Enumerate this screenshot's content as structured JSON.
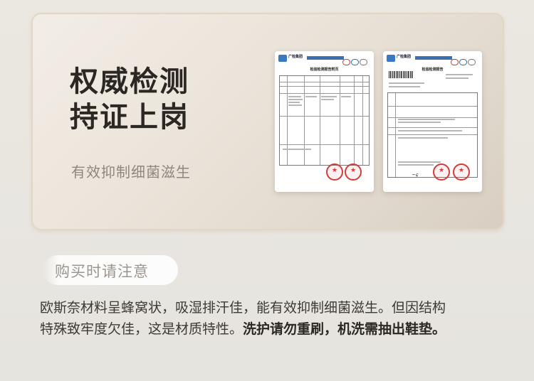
{
  "card": {
    "title_line1": "权威检测",
    "title_line2": "持证上岗",
    "subtitle": "有效抑制细菌滋生"
  },
  "reports": [
    {
      "header_org": "广检集团",
      "title": "检验检测报告附页",
      "icons": [
        "logo-icon",
        "cma-badge-icon",
        "cnas-badge-icon",
        "cert-badge-icon",
        "red-seal-icon"
      ]
    },
    {
      "header_org": "广检集团",
      "title": "检验检测报告",
      "icons": [
        "logo-icon",
        "barcode-icon",
        "cma-badge-icon",
        "cnas-badge-icon",
        "red-seal-icon"
      ]
    }
  ],
  "notice": {
    "title": "购买时请注意",
    "line1": "欧斯奈材料呈蜂窝状，吸湿排汗佳，能有效抑制细菌滋生。但因结构",
    "line2_plain": "特殊致牢度欠佳，这是材质特性。",
    "line2_bold": "洗护请勿重刷，机洗需抽出鞋垫。"
  },
  "colors": {
    "title_text": "#2b2723",
    "subtitle_text": "#8d8780",
    "card_border": "#e3d7c3",
    "stamp_red": "#d33a3a",
    "body_text": "#3d3934"
  }
}
